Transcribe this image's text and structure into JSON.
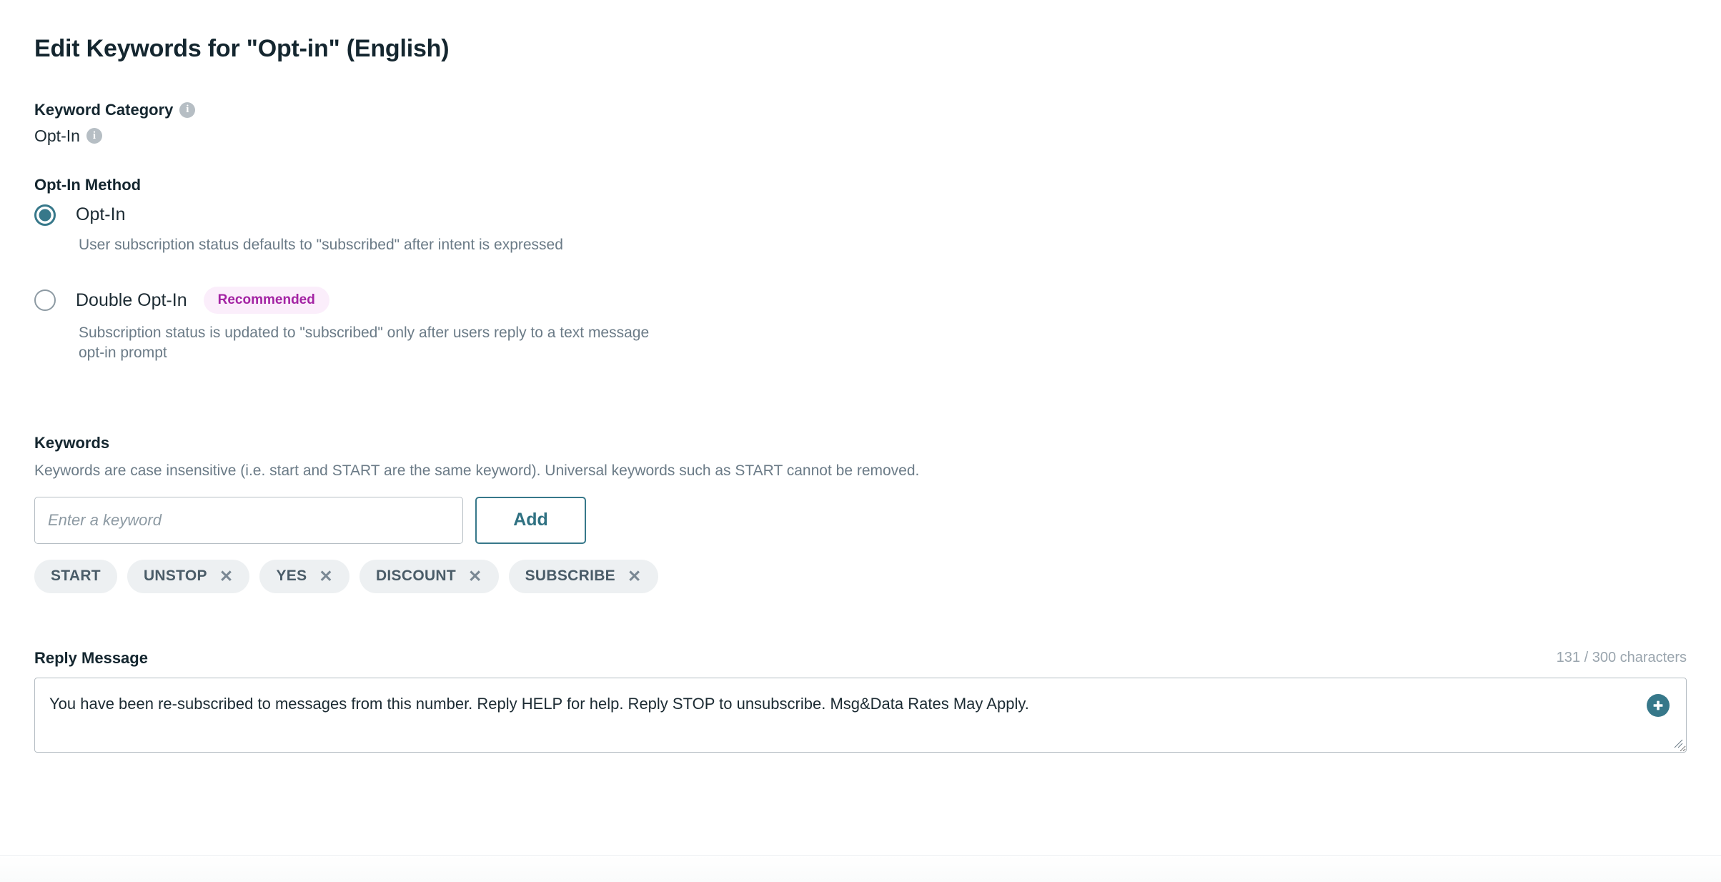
{
  "page": {
    "title": "Edit Keywords for \"Opt-in\" (English)"
  },
  "keyword_category": {
    "label": "Keyword Category",
    "info_icon": "info-icon",
    "value": "Opt-In",
    "value_info_icon": "info-icon"
  },
  "optin_method": {
    "label": "Opt-In Method",
    "options": [
      {
        "label": "Opt-In",
        "selected": true,
        "description": "User subscription status defaults to \"subscribed\" after intent is expressed",
        "badge": ""
      },
      {
        "label": "Double Opt-In",
        "selected": false,
        "description": "Subscription status is updated to \"subscribed\" only after users reply to a text message opt-in prompt",
        "badge": "Recommended"
      }
    ]
  },
  "keywords": {
    "label": "Keywords",
    "help": "Keywords are case insensitive (i.e. start and START are the same keyword). Universal keywords such as START cannot be removed.",
    "input_placeholder": "Enter a keyword",
    "input_value": "",
    "add_label": "Add",
    "chips": [
      {
        "label": "START",
        "removable": false,
        "remove_glyph": ""
      },
      {
        "label": "UNSTOP",
        "removable": true,
        "remove_glyph": "✕"
      },
      {
        "label": "YES",
        "removable": true,
        "remove_glyph": "✕"
      },
      {
        "label": "DISCOUNT",
        "removable": true,
        "remove_glyph": "✕"
      },
      {
        "label": "SUBSCRIBE",
        "removable": true,
        "remove_glyph": "✕"
      }
    ]
  },
  "reply_message": {
    "label": "Reply Message",
    "char_count": "131 / 300 characters",
    "value": "You have been re-subscribed to messages from this number. Reply HELP for help. Reply STOP to unsubscribe. Msg&Data Rates May Apply.",
    "placeholder": "",
    "insert_icon": "plus-circle-icon"
  },
  "colors": {
    "accent_teal": "#37788a",
    "badge_text": "#a323a3",
    "badge_bg": "#fbeefb",
    "chip_bg": "#edf0f2",
    "muted_text": "#6b7b87",
    "heading": "#14262f"
  }
}
